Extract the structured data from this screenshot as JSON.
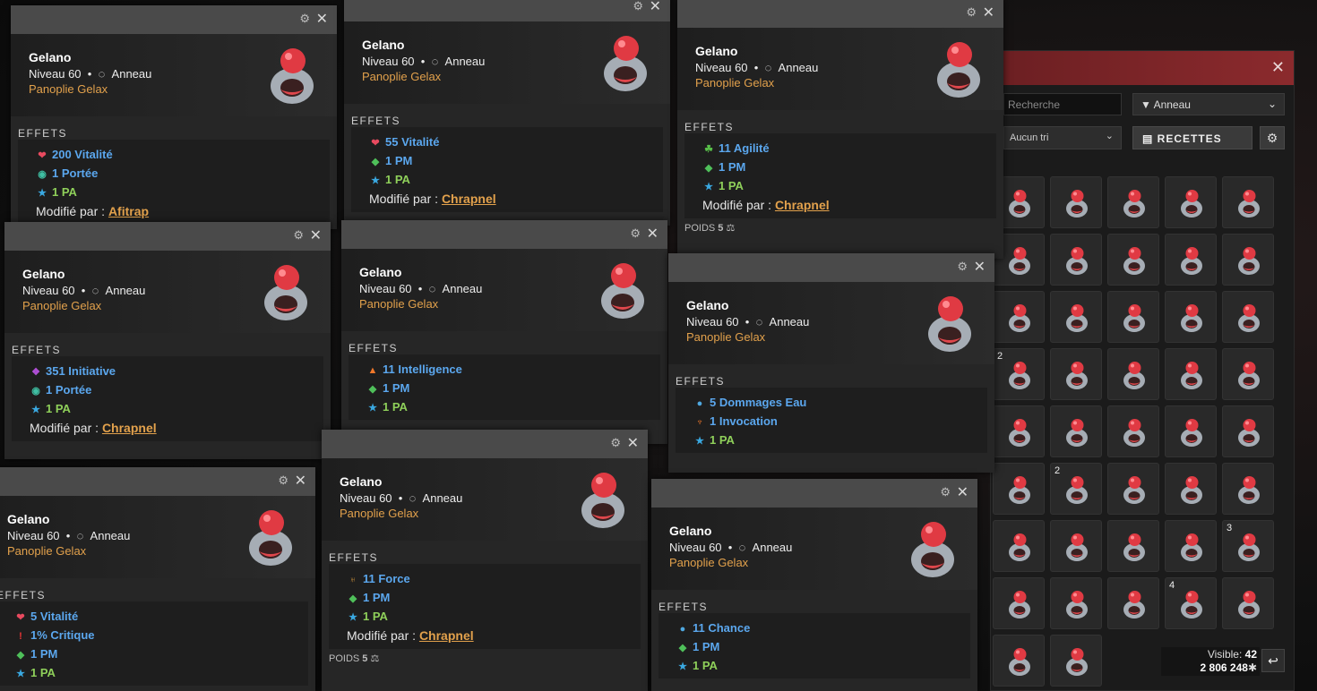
{
  "inventory": {
    "search_placeholder": "Recherche",
    "filter_label": "Anneau",
    "sort_label": "Aucun tri",
    "recipes_label": "RECETTES",
    "visible_label": "Visible:",
    "visible_count": "42",
    "kamas": "2 806 248",
    "slot_quantities": [
      "",
      "",
      "",
      "",
      "",
      "",
      "",
      "",
      "",
      "",
      "",
      "",
      "",
      "",
      "",
      "2",
      "",
      "",
      "",
      "",
      "",
      "",
      "",
      "",
      "",
      "",
      "2",
      "",
      "",
      "",
      "",
      "",
      "",
      "",
      "3",
      "",
      "",
      "",
      "4",
      "",
      "",
      "",
      "",
      "",
      ""
    ]
  },
  "tooltips": [
    {
      "name": "Gelano",
      "level": "Niveau 60",
      "bullet": "•",
      "type": "Anneau",
      "set": "Panoplie Gelax",
      "effects_label": "EFFETS",
      "effects": [
        {
          "icon": "heart-icon",
          "text": "200 Vitalité",
          "color": "#5ba7ee"
        },
        {
          "icon": "eye-icon",
          "text": "1 Portée",
          "color": "#5ba7ee"
        },
        {
          "icon": "star-icon",
          "text": "1 PA",
          "color": "#8fd05a"
        }
      ],
      "modified_by_label": "Modifié par :",
      "modified_by": "Afitrap"
    },
    {
      "name": "Gelano",
      "level": "Niveau 60",
      "bullet": "•",
      "type": "Anneau",
      "set": "Panoplie Gelax",
      "effects_label": "EFFETS",
      "effects": [
        {
          "icon": "heart-icon",
          "text": "55 Vitalité",
          "color": "#5ba7ee"
        },
        {
          "icon": "diamond-icon",
          "text": "1 PM",
          "color": "#5ba7ee"
        },
        {
          "icon": "star-icon",
          "text": "1 PA",
          "color": "#8fd05a"
        }
      ],
      "modified_by_label": "Modifié par :",
      "modified_by": "Chrapnel"
    },
    {
      "name": "Gelano",
      "level": "Niveau 60",
      "bullet": "•",
      "type": "Anneau",
      "set": "Panoplie Gelax",
      "effects_label": "EFFETS",
      "effects": [
        {
          "icon": "agility-icon",
          "text": "11 Agilité",
          "color": "#5ba7ee"
        },
        {
          "icon": "diamond-icon",
          "text": "1 PM",
          "color": "#5ba7ee"
        },
        {
          "icon": "star-icon",
          "text": "1 PA",
          "color": "#8fd05a"
        }
      ],
      "modified_by_label": "Modifié par :",
      "modified_by": "Chrapnel",
      "weight_label": "POIDS",
      "weight": "5"
    },
    {
      "name": "Gelano",
      "level": "Niveau 60",
      "bullet": "•",
      "type": "Anneau",
      "set": "Panoplie Gelax",
      "effects_label": "EFFETS",
      "effects": [
        {
          "icon": "initiative-icon",
          "text": "351 Initiative",
          "color": "#5ba7ee"
        },
        {
          "icon": "eye-icon",
          "text": "1 Portée",
          "color": "#5ba7ee"
        },
        {
          "icon": "star-icon",
          "text": "1 PA",
          "color": "#8fd05a"
        }
      ],
      "modified_by_label": "Modifié par :",
      "modified_by": "Chrapnel"
    },
    {
      "name": "Gelano",
      "level": "Niveau 60",
      "bullet": "•",
      "type": "Anneau",
      "set": "Panoplie Gelax",
      "effects_label": "EFFETS",
      "effects": [
        {
          "icon": "fire-icon",
          "text": "11 Intelligence",
          "color": "#5ba7ee"
        },
        {
          "icon": "diamond-icon",
          "text": "1 PM",
          "color": "#5ba7ee"
        },
        {
          "icon": "star-icon",
          "text": "1 PA",
          "color": "#8fd05a"
        }
      ]
    },
    {
      "name": "Gelano",
      "level": "Niveau 60",
      "bullet": "•",
      "type": "Anneau",
      "set": "Panoplie Gelax",
      "effects_label": "EFFETS",
      "effects": [
        {
          "icon": "water-icon",
          "text": "5 Dommages Eau",
          "color": "#5ba7ee"
        },
        {
          "icon": "summon-icon",
          "text": "1 Invocation",
          "color": "#5ba7ee"
        },
        {
          "icon": "star-icon",
          "text": "1 PA",
          "color": "#8fd05a"
        }
      ]
    },
    {
      "name": "Gelano",
      "level": "Niveau 60",
      "bullet": "•",
      "type": "Anneau",
      "set": "Panoplie Gelax",
      "effects_label": "EFFETS",
      "effects": [
        {
          "icon": "heart-icon",
          "text": "5 Vitalité",
          "color": "#5ba7ee"
        },
        {
          "icon": "critical-icon",
          "text": "1% Critique",
          "color": "#5ba7ee"
        },
        {
          "icon": "diamond-icon",
          "text": "1 PM",
          "color": "#5ba7ee"
        },
        {
          "icon": "star-icon",
          "text": "1 PA",
          "color": "#8fd05a"
        }
      ]
    },
    {
      "name": "Gelano",
      "level": "Niveau 60",
      "bullet": "•",
      "type": "Anneau",
      "set": "Panoplie Gelax",
      "effects_label": "EFFETS",
      "effects": [
        {
          "icon": "strength-icon",
          "text": "11 Force",
          "color": "#5ba7ee"
        },
        {
          "icon": "diamond-icon",
          "text": "1 PM",
          "color": "#5ba7ee"
        },
        {
          "icon": "star-icon",
          "text": "1 PA",
          "color": "#8fd05a"
        }
      ],
      "modified_by_label": "Modifié par :",
      "modified_by": "Chrapnel",
      "weight_label": "POIDS",
      "weight": "5"
    },
    {
      "name": "Gelano",
      "level": "Niveau 60",
      "bullet": "•",
      "type": "Anneau",
      "set": "Panoplie Gelax",
      "effects_label": "EFFETS",
      "effects": [
        {
          "icon": "water-icon",
          "text": "11 Chance",
          "color": "#5ba7ee"
        },
        {
          "icon": "diamond-icon",
          "text": "1 PM",
          "color": "#5ba7ee"
        },
        {
          "icon": "star-icon",
          "text": "1 PA",
          "color": "#8fd05a"
        }
      ]
    }
  ]
}
